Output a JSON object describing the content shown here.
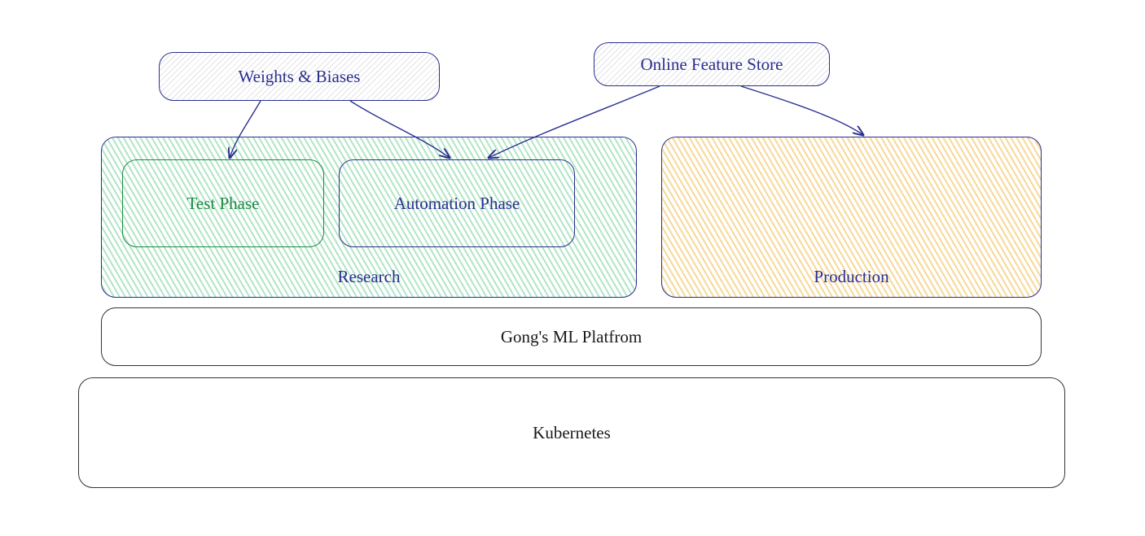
{
  "top": {
    "weights_biases": "Weights & Biases",
    "online_feature_store": "Online Feature Store"
  },
  "research": {
    "label": "Research",
    "test_phase": "Test Phase",
    "automation_phase": "Automation Phase"
  },
  "production": {
    "label": "Production"
  },
  "platform": {
    "label": "Gong's ML Platfrom"
  },
  "kubernetes": {
    "label": "Kubernetes"
  },
  "colors": {
    "blue": "#2a2f8f",
    "green": "#1e8a46",
    "orange": "#f0b941",
    "gray": "#333333"
  },
  "arrows": [
    {
      "from": "weights_biases",
      "to": "test_phase"
    },
    {
      "from": "weights_biases",
      "to": "automation_phase"
    },
    {
      "from": "online_feature_store",
      "to": "automation_phase"
    },
    {
      "from": "online_feature_store",
      "to": "production"
    }
  ]
}
